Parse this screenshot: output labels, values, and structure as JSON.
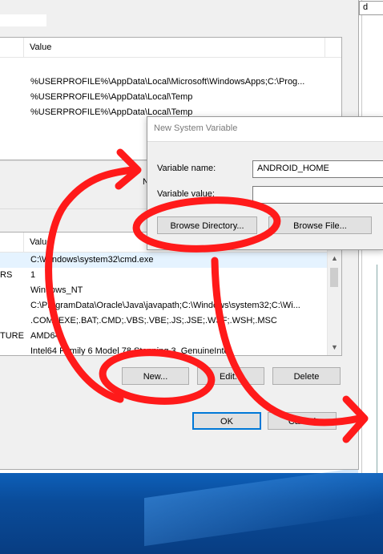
{
  "top_right_field": "d",
  "user_vars": {
    "header_name": "",
    "header_value": "Value",
    "rows": [
      {
        "value": "%USERPROFILE%\\AppData\\Local\\Microsoft\\WindowsApps;C:\\Prog..."
      },
      {
        "value": "%USERPROFILE%\\AppData\\Local\\Temp"
      },
      {
        "value": "%USERPROFILE%\\AppData\\Local\\Temp"
      }
    ]
  },
  "hidden_new_fragment": "N",
  "system_vars": {
    "header_value": "Value",
    "rows": [
      {
        "name": "",
        "value": "C:\\Windows\\system32\\cmd.exe",
        "selected": true
      },
      {
        "name": "RS",
        "value": "1"
      },
      {
        "name": "",
        "value": "Windows_NT"
      },
      {
        "name": "",
        "value": "C:\\ProgramData\\Oracle\\Java\\javapath;C:\\Windows\\system32;C:\\Wi..."
      },
      {
        "name": "",
        "value": ".COM;.EXE;.BAT;.CMD;.VBS;.VBE;.JS;.JSE;.WSF;.WSH;.MSC"
      },
      {
        "name": "TURE",
        "value": "AMD64"
      },
      {
        "name": "",
        "value": "Intel64 Family 6 Model 78 Stepping 3, GenuineIntel"
      }
    ]
  },
  "buttons": {
    "new": "New...",
    "edit": "Edit...",
    "delete": "Delete",
    "ok": "OK",
    "cancel": "Cancel"
  },
  "dialog": {
    "title": "New System Variable",
    "name_label": "Variable name:",
    "name_value": "ANDROID_HOME",
    "value_label": "Variable value:",
    "value_value": "",
    "browse_directory": "Browse Directory...",
    "browse_file": "Browse File..."
  },
  "colors": {
    "annotation": "#ff0000",
    "selection": "#e5f3ff",
    "desktop": "#0a4c9a"
  }
}
